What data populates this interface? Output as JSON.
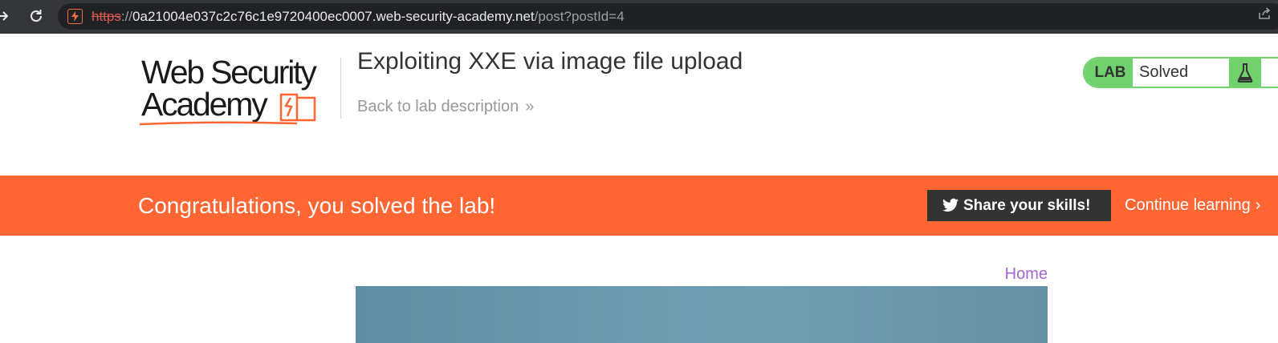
{
  "browser": {
    "url_scheme": "https",
    "url_separator": "://",
    "url_host": "0a21004e037c2c76c1e9720400ec0007.web-security-academy.net",
    "url_path": "/post?postId=4",
    "forward_icon": "arrow-right",
    "reload_icon": "reload",
    "share_icon": "share"
  },
  "header": {
    "logo_line1": "Web Security",
    "logo_line2": "Academy",
    "lab_title": "Exploiting XXE via image file upload",
    "back_link": "Back to lab description",
    "back_chevrons": "»",
    "status_tag": "LAB",
    "status_text": "Solved",
    "status_icon": "flask"
  },
  "banner": {
    "message": "Congratulations, you solved the lab!",
    "share_button": "Share your skills!",
    "continue_link": "Continue learning",
    "continue_chevron": "›"
  },
  "content": {
    "home_link": "Home"
  },
  "colors": {
    "brand_orange": "#ff6633",
    "solved_green": "#70d16d",
    "link_purple": "#a166d1",
    "chrome_dark": "#35363a"
  }
}
